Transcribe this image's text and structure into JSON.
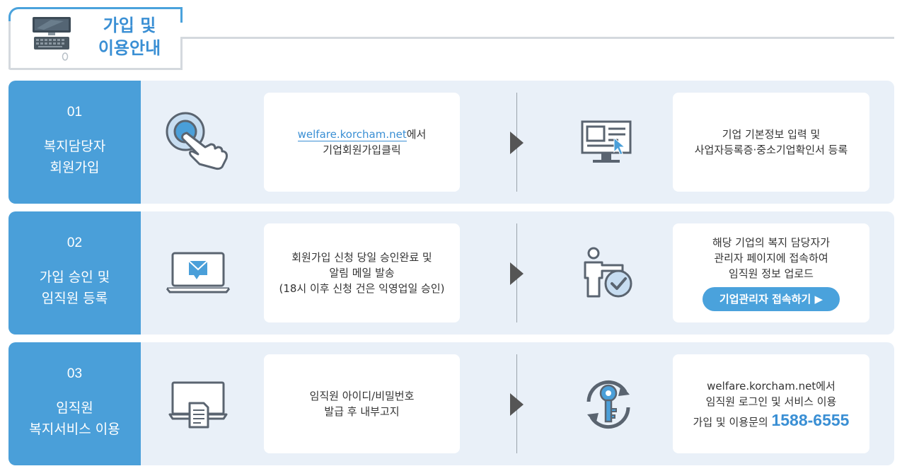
{
  "header": {
    "title_line1": "가입 및",
    "title_line2": "이용안내"
  },
  "steps": [
    {
      "num": "01",
      "title_line1": "복지담당자",
      "title_line2": "회원가입",
      "left_card": {
        "link": "welfare.korcham.net",
        "link_suffix": "에서",
        "line2": "기업회원가입클릭"
      },
      "right_card": {
        "line1": "기업 기본정보 입력 및",
        "line2": "사업자등록증·중소기업확인서 등록"
      }
    },
    {
      "num": "02",
      "title_line1": "가입 승인 및",
      "title_line2": "임직원 등록",
      "left_card": {
        "line1": "회원가입 신청 당일 승인완료 및",
        "line2": "알림 메일 발송",
        "line3": "(18시 이후 신청 건은 익영업일 승인)"
      },
      "right_card": {
        "line1": "해당 기업의 복지 담당자가",
        "line2": "관리자 페이지에 접속하여",
        "line3": "임직원 정보 업로드",
        "button": "기업관리자 접속하기 ▶"
      }
    },
    {
      "num": "03",
      "title_line1": "임직원",
      "title_line2": "복지서비스 이용",
      "left_card": {
        "line1": "임직원 아이디/비밀번호",
        "line2": "발급 후 내부고지"
      },
      "right_card": {
        "line1": "welfare.korcham.net에서",
        "line2": "임직원 로그인 및 서비스 이용",
        "line3_prefix": "가입 및 이용문의 ",
        "phone": "1588-6555"
      }
    }
  ],
  "colors": {
    "accent": "#4a9fd9",
    "row_bg": "#e9f0f8",
    "text": "#333333"
  }
}
